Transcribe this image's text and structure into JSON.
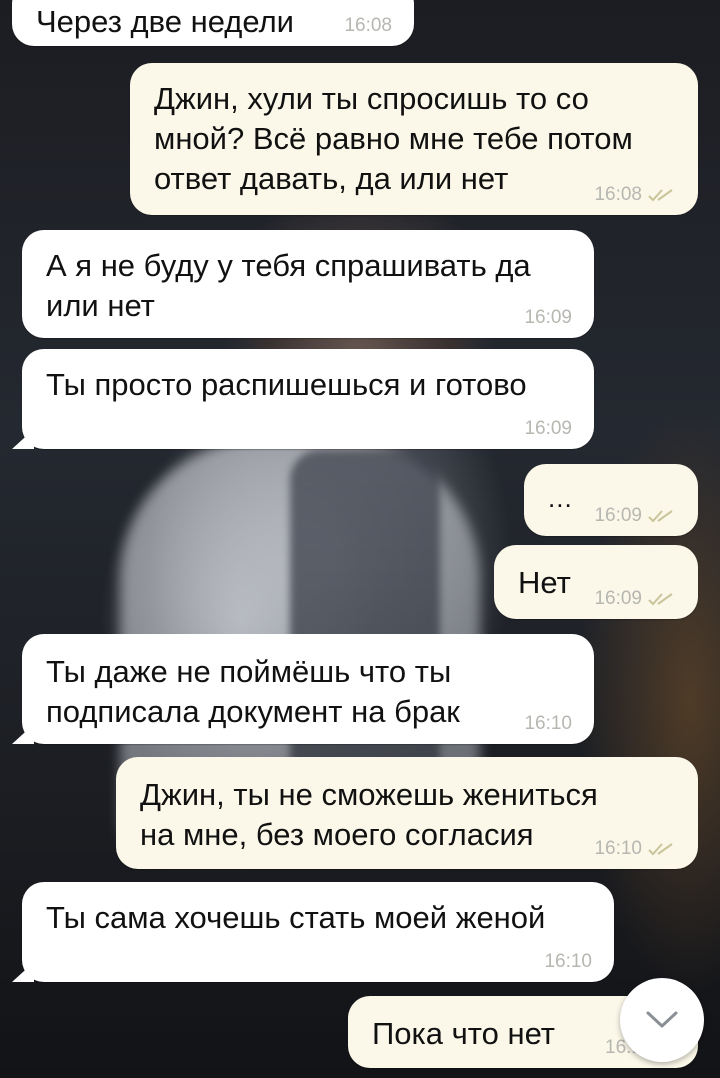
{
  "messages": [
    {
      "id": "m1",
      "direction": "in",
      "text": "Через две недели",
      "time": "16:08"
    },
    {
      "id": "m2",
      "direction": "out",
      "text": "Джин, хули ты спросишь то со\nмной? Всё равно мне тебе потом\nответ давать, да или нет",
      "time": "16:08",
      "status": "read"
    },
    {
      "id": "m3",
      "direction": "in",
      "text": "А я не буду у тебя спрашивать да\nили нет",
      "time": "16:09"
    },
    {
      "id": "m4",
      "direction": "in",
      "text": "Ты просто распишешься и готово",
      "time": "16:09"
    },
    {
      "id": "m5",
      "direction": "out",
      "text": "...",
      "time": "16:09",
      "status": "read"
    },
    {
      "id": "m6",
      "direction": "out",
      "text": "Нет",
      "time": "16:09",
      "status": "read"
    },
    {
      "id": "m7",
      "direction": "in",
      "text": "Ты даже не поймёшь что ты\nподписала документ на брак",
      "time": "16:10"
    },
    {
      "id": "m8",
      "direction": "out",
      "text": "Джин, ты не сможешь жениться\nна мне, без моего согласия",
      "time": "16:10",
      "status": "read"
    },
    {
      "id": "m9",
      "direction": "in",
      "text": "Ты сама хочешь стать моей женой",
      "time": "16:10"
    },
    {
      "id": "m10",
      "direction": "out",
      "text": "Пока что нет",
      "time": "16:1",
      "status": "read"
    }
  ],
  "scroll_button": {
    "icon": "chevron-down-icon"
  },
  "colors": {
    "incoming_bubble": "#ffffff",
    "outgoing_bubble": "#fbf8e9",
    "timestamp": "#b7b7b2",
    "read_ticks": "#c9c49a"
  }
}
